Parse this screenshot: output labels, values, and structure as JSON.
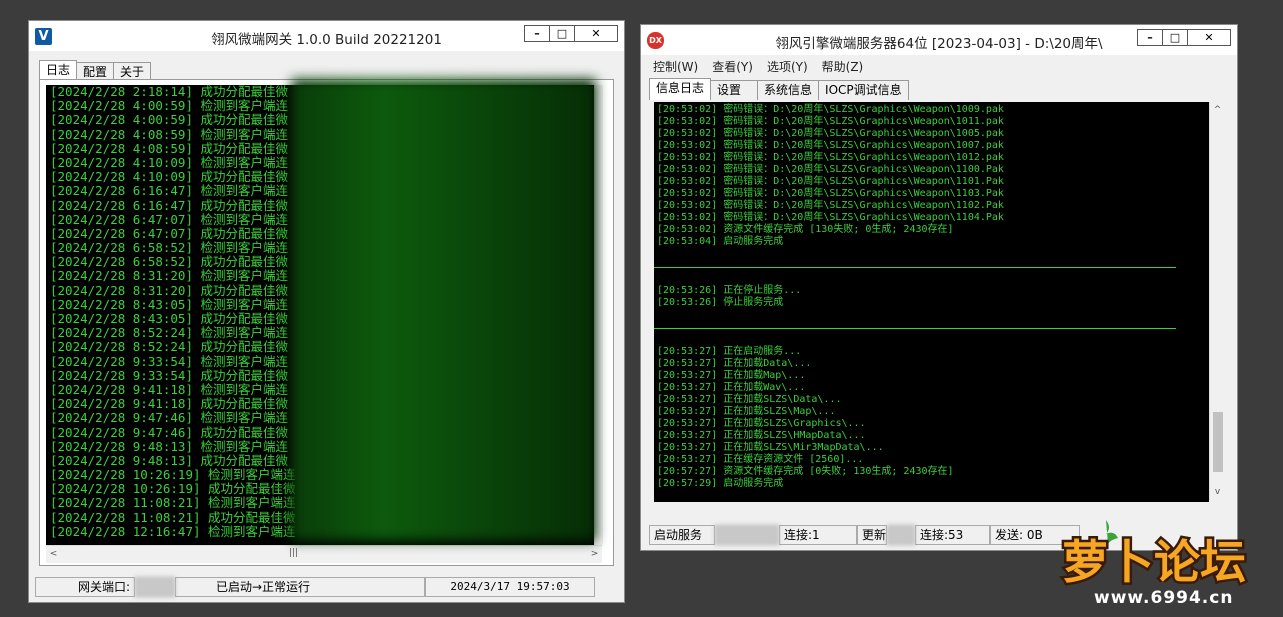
{
  "gateway": {
    "title": "翎风微端网关 1.0.0 Build 20221201",
    "tabs": [
      "日志",
      "配置",
      "关于"
    ],
    "log_lines": [
      "[2024/2/28 2:18:14] 成功分配最佳微",
      "[2024/2/28 4:00:59] 检测到客户端连",
      "[2024/2/28 4:00:59] 成功分配最佳微",
      "[2024/2/28 4:08:59] 检测到客户端连",
      "[2024/2/28 4:08:59] 成功分配最佳微",
      "[2024/2/28 4:10:09] 检测到客户端连",
      "[2024/2/28 4:10:09] 成功分配最佳微",
      "[2024/2/28 6:16:47] 检测到客户端连",
      "[2024/2/28 6:16:47] 成功分配最佳微",
      "[2024/2/28 6:47:07] 检测到客户端连",
      "[2024/2/28 6:47:07] 成功分配最佳微",
      "[2024/2/28 6:58:52] 检测到客户端连",
      "[2024/2/28 6:58:52] 成功分配最佳微",
      "[2024/2/28 8:31:20] 检测到客户端连",
      "[2024/2/28 8:31:20] 成功分配最佳微",
      "[2024/2/28 8:43:05] 检测到客户端连",
      "[2024/2/28 8:43:05] 成功分配最佳微",
      "[2024/2/28 8:52:24] 检测到客户端连",
      "[2024/2/28 8:52:24] 成功分配最佳微",
      "[2024/2/28 9:33:54] 检测到客户端连",
      "[2024/2/28 9:33:54] 成功分配最佳微",
      "[2024/2/28 9:41:18] 检测到客户端连",
      "[2024/2/28 9:41:18] 成功分配最佳微",
      "[2024/2/28 9:47:46] 检测到客户端连",
      "[2024/2/28 9:47:46] 成功分配最佳微",
      "[2024/2/28 9:48:13] 检测到客户端连",
      "[2024/2/28 9:48:13] 成功分配最佳微",
      "[2024/2/28 10:26:19] 检测到客户端连",
      "[2024/2/28 10:26:19] 成功分配最佳微",
      "[2024/2/28 11:08:21] 检测到客户端连",
      "[2024/2/28 11:08:21] 成功分配最佳微",
      "[2024/2/28 12:16:47] 检测到客户端连"
    ],
    "status": {
      "port_label": "网关端口:",
      "state": "已启动→正常运行",
      "time": "2024/3/17 19:57:03"
    }
  },
  "server": {
    "title": "翎风引擎微端服务器64位 [2023-04-03] - D:\\20周年\\",
    "menus": [
      "控制(W)",
      "查看(Y)",
      "选项(Y)",
      "帮助(Z)"
    ],
    "tabs": [
      "信息日志",
      "设置",
      "系统信息",
      "IOCP调试信息"
    ],
    "log_top": [
      "[20:53:02] 密码错误：D:\\20周年\\SLZS\\Graphics\\Weapon\\1009.pak",
      "[20:53:02] 密码错误：D:\\20周年\\SLZS\\Graphics\\Weapon\\1011.pak",
      "[20:53:02] 密码错误：D:\\20周年\\SLZS\\Graphics\\Weapon\\1005.pak",
      "[20:53:02] 密码错误：D:\\20周年\\SLZS\\Graphics\\Weapon\\1007.pak",
      "[20:53:02] 密码错误：D:\\20周年\\SLZS\\Graphics\\Weapon\\1012.pak",
      "[20:53:02] 密码错误：D:\\20周年\\SLZS\\Graphics\\Weapon\\1100.Pak",
      "[20:53:02] 密码错误：D:\\20周年\\SLZS\\Graphics\\Weapon\\1101.Pak",
      "[20:53:02] 密码错误：D:\\20周年\\SLZS\\Graphics\\Weapon\\1103.Pak",
      "[20:53:02] 密码错误：D:\\20周年\\SLZS\\Graphics\\Weapon\\1102.Pak",
      "[20:53:02] 密码错误：D:\\20周年\\SLZS\\Graphics\\Weapon\\1104.Pak",
      "[20:53:02] 资源文件缓存完成 [130失败; 0生成; 2430存在]",
      "[20:53:04] 启动服务完成"
    ],
    "log_mid": [
      "[20:53:26] 正在停止服务...",
      "[20:53:26] 停止服务完成"
    ],
    "log_bottom": [
      "[20:53:27] 正在启动服务...",
      "[20:53:27] 正在加载Data\\...",
      "[20:53:27] 正在加载Map\\...",
      "[20:53:27] 正在加载Wav\\...",
      "[20:53:27] 正在加载SLZS\\Data\\...",
      "[20:53:27] 正在加载SLZS\\Map\\...",
      "[20:53:27] 正在加载SLZS\\Graphics\\...",
      "[20:53:27] 正在加载SLZS\\HMapData\\...",
      "[20:53:27] 正在加载SLZS\\Mir3MapData\\...",
      "[20:53:27] 正在缓存资源文件 [2560]...",
      "[20:57:27] 资源文件缓存完成 [0失败; 130生成; 2430存在]",
      "[20:57:29] 启动服务完成"
    ],
    "status": {
      "start_btn": "启动服务",
      "conn1": "连接:1",
      "update": "更新",
      "conn2": "连接:53",
      "send": "发送: 0B"
    }
  },
  "watermark": {
    "brand": "萝卜论坛",
    "url": "www.6994.cn"
  },
  "colors": {
    "log_text": "#3bd13b",
    "log_bg": "#000000"
  }
}
